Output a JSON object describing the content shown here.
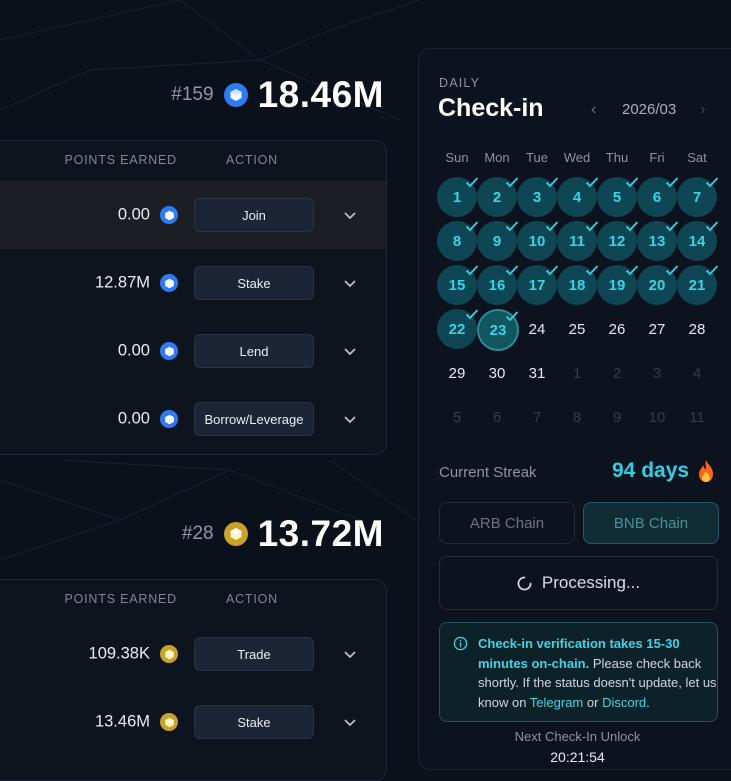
{
  "section1": {
    "rank": "#159",
    "total": "18.46M",
    "coin_color": "#2e7bf6",
    "headers": {
      "points": "POINTS EARNED",
      "action": "ACTION"
    },
    "rows": [
      {
        "points": "0.00",
        "action": "Join",
        "highlight": true
      },
      {
        "points": "12.87M",
        "action": "Stake"
      },
      {
        "points": "0.00",
        "action": "Lend"
      },
      {
        "points": "0.00",
        "action": "Borrow/Leverage"
      }
    ]
  },
  "section2": {
    "rank": "#28",
    "total": "13.72M",
    "coin_color": "#c9a22a",
    "headers": {
      "points": "POINTS EARNED",
      "action": "ACTION"
    },
    "rows": [
      {
        "points": "109.38K",
        "action": "Trade"
      },
      {
        "points": "13.46M",
        "action": "Stake"
      }
    ]
  },
  "checkin": {
    "overline": "DAILY",
    "title": "Check-in",
    "month": "2026/03",
    "weekdays": [
      "Sun",
      "Mon",
      "Tue",
      "Wed",
      "Thu",
      "Fri",
      "Sat"
    ],
    "days": [
      {
        "n": "1",
        "s": "done"
      },
      {
        "n": "2",
        "s": "done"
      },
      {
        "n": "3",
        "s": "done"
      },
      {
        "n": "4",
        "s": "done"
      },
      {
        "n": "5",
        "s": "done"
      },
      {
        "n": "6",
        "s": "done"
      },
      {
        "n": "7",
        "s": "done"
      },
      {
        "n": "8",
        "s": "done"
      },
      {
        "n": "9",
        "s": "done"
      },
      {
        "n": "10",
        "s": "done"
      },
      {
        "n": "11",
        "s": "done"
      },
      {
        "n": "12",
        "s": "done"
      },
      {
        "n": "13",
        "s": "done"
      },
      {
        "n": "14",
        "s": "done"
      },
      {
        "n": "15",
        "s": "done"
      },
      {
        "n": "16",
        "s": "done"
      },
      {
        "n": "17",
        "s": "done"
      },
      {
        "n": "18",
        "s": "done"
      },
      {
        "n": "19",
        "s": "done"
      },
      {
        "n": "20",
        "s": "done"
      },
      {
        "n": "21",
        "s": "done"
      },
      {
        "n": "22",
        "s": "done"
      },
      {
        "n": "23",
        "s": "today"
      },
      {
        "n": "24",
        "s": "norm"
      },
      {
        "n": "25",
        "s": "norm"
      },
      {
        "n": "26",
        "s": "norm"
      },
      {
        "n": "27",
        "s": "norm"
      },
      {
        "n": "28",
        "s": "norm"
      },
      {
        "n": "29",
        "s": "norm"
      },
      {
        "n": "30",
        "s": "norm"
      },
      {
        "n": "31",
        "s": "norm"
      },
      {
        "n": "1",
        "s": "dim"
      },
      {
        "n": "2",
        "s": "dim"
      },
      {
        "n": "3",
        "s": "dim"
      },
      {
        "n": "4",
        "s": "dim"
      },
      {
        "n": "5",
        "s": "dim"
      },
      {
        "n": "6",
        "s": "dim"
      },
      {
        "n": "7",
        "s": "dim"
      },
      {
        "n": "8",
        "s": "dim"
      },
      {
        "n": "9",
        "s": "dim"
      },
      {
        "n": "10",
        "s": "dim"
      },
      {
        "n": "11",
        "s": "dim"
      }
    ],
    "streak_label": "Current Streak",
    "streak_value": "94 days",
    "chains": {
      "arb": "ARB Chain",
      "bnb": "BNB Chain"
    },
    "processing": "Processing...",
    "info": {
      "bold": "Check-in verification takes 15-30 minutes on-chain.",
      "text1": " Please check back shortly. If the status doesn't update, let us know on ",
      "telegram": "Telegram",
      "or": " or ",
      "discord": "Discord",
      "end": "."
    },
    "next_label": "Next Check-In Unlock",
    "next_value": "20:21:54"
  },
  "colors": {
    "accent": "#2fd0e6",
    "done_bg": "#0f4654"
  }
}
